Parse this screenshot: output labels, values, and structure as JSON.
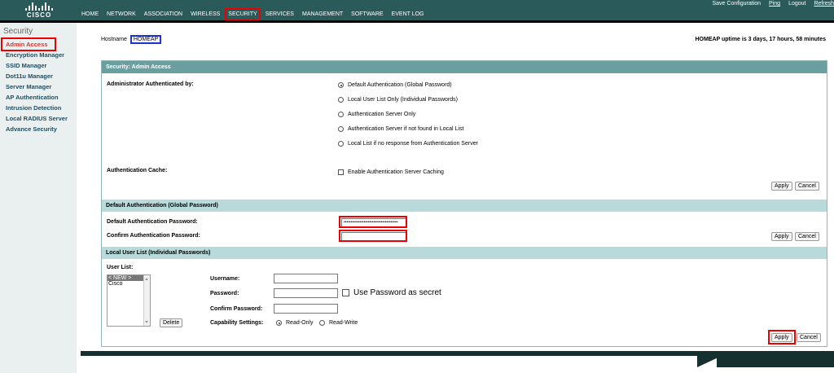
{
  "brand": {
    "logo_text": "CISCO"
  },
  "header": {
    "right_links": [
      "Save Configuration",
      "Ping",
      "Logout",
      "Refresh"
    ],
    "nav": [
      "HOME",
      "NETWORK",
      "ASSOCIATION",
      "WIRELESS",
      "SECURITY",
      "SERVICES",
      "MANAGEMENT",
      "SOFTWARE",
      "EVENT LOG"
    ],
    "active_nav": "SECURITY"
  },
  "sidebar": {
    "title": "Security",
    "items": [
      "Admin Access",
      "Encryption Manager",
      "SSID Manager",
      "Dot11u Manager",
      "Server Manager",
      "AP Authentication",
      "Intrusion Detection",
      "Local RADIUS Server",
      "Advance Security"
    ]
  },
  "host": {
    "label": "Hostname",
    "name": "HOMEAP",
    "uptime": "HOMEAP uptime is 3 days, 17 hours, 58 minutes"
  },
  "admin": {
    "heading": "Security: Admin Access",
    "auth_label": "Administrator Authenticated by:",
    "options": [
      "Default Authentication (Global Password)",
      "Local User List Only (Individual Passwords)",
      "Authentication Server Only",
      "Authentication Server if not found in Local List",
      "Local List if no response from Authentication Server"
    ],
    "selected_option": 0,
    "cache_label": "Authentication Cache:",
    "cache_option": "Enable Authentication Server Caching",
    "cache_checked": false,
    "apply": "Apply",
    "cancel": "Cancel"
  },
  "default_auth": {
    "heading": "Default Authentication (Global Password)",
    "password_label": "Default Authentication Password:",
    "password_value": "••••••••••••••••••••••••••••••••••••••",
    "confirm_label": "Confirm Authentication Password:",
    "confirm_value": "",
    "apply": "Apply",
    "cancel": "Cancel"
  },
  "local_users": {
    "heading": "Local User List (Individual Passwords)",
    "list_label": "User List:",
    "list_items": [
      "< NEW >",
      "Cisco"
    ],
    "delete": "Delete",
    "username_label": "Username:",
    "username_value": "",
    "password_label": "Password:",
    "password_value": "",
    "secret_label": "Use Password as secret",
    "confirm_label": "Confirm Password:",
    "confirm_value": "",
    "capability_label": "Capability Settings:",
    "capability_options": [
      "Read-Only",
      "Read-Write"
    ],
    "capability_selected": 0,
    "apply": "Apply",
    "cancel": "Cancel"
  }
}
